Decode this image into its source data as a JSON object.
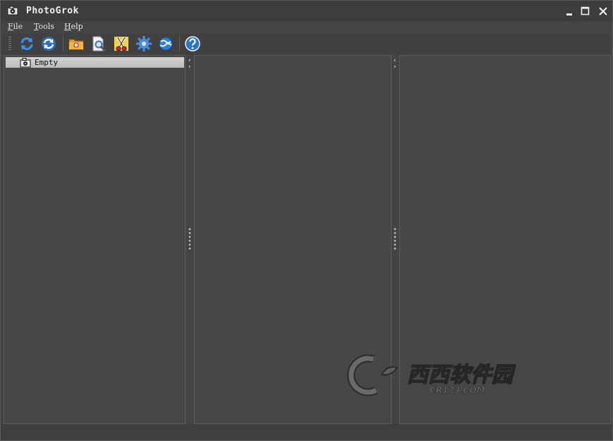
{
  "window": {
    "title": "PhotoGrok",
    "controls": [
      "minimize-icon",
      "maximize-icon",
      "close-icon"
    ]
  },
  "menu": {
    "file": {
      "mnemonic": "F",
      "rest": "ile"
    },
    "tools": {
      "mnemonic": "T",
      "rest": "ools"
    },
    "help": {
      "mnemonic": "H",
      "rest": "elp"
    }
  },
  "toolbar": {
    "icons": [
      "refresh-icon",
      "refresh-all-icon",
      "open-folder-icon",
      "search-icon",
      "cut-icon",
      "settings-gear-icon",
      "web-globe-icon",
      "help-icon"
    ]
  },
  "tree": {
    "items": [
      {
        "label": "Empty",
        "icon": "camera-icon"
      }
    ]
  },
  "watermark": {
    "brand": "西西软件园",
    "domain": "CR173.COM"
  },
  "colors": {
    "background": "#444444",
    "panel": "#474747",
    "tree_selection": "#c8c8c8",
    "accent_blue": "#2f7fd6"
  }
}
